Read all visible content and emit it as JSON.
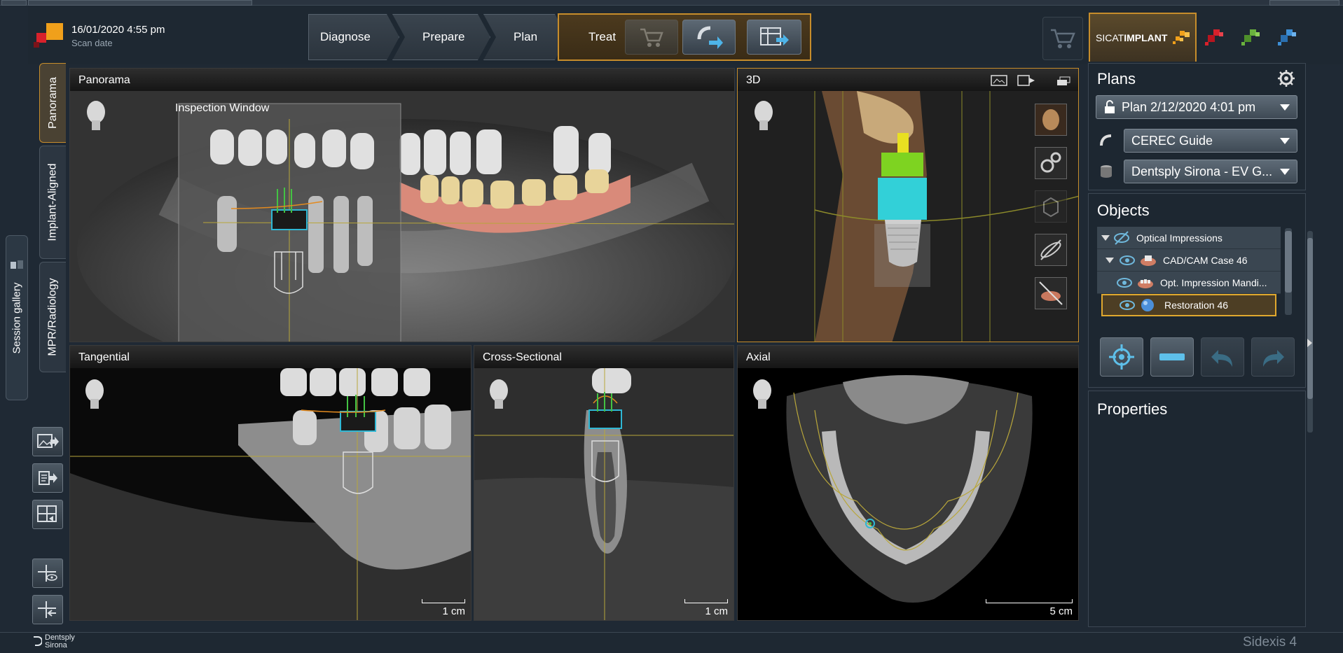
{
  "header": {
    "scan_date": "16/01/2020 4:55 pm",
    "scan_label": "Scan date"
  },
  "workflow": {
    "steps": [
      "Diagnose",
      "Prepare",
      "Plan",
      "Treat"
    ],
    "active_step": "Treat"
  },
  "apps": {
    "sicat_prefix": "SICAT",
    "sicat_suffix": "IMPLANT",
    "accent_color": "#c78d2b",
    "app_icon_colors": [
      "#d8212b",
      "#6ab23e",
      "#3d8fd6"
    ]
  },
  "left_tabs": [
    "Panorama",
    "Implant-Aligned",
    "MPR/Radiology"
  ],
  "session_gallery": "Session gallery",
  "viewports": {
    "panorama": {
      "title": "Panorama",
      "inspection": "Inspection Window"
    },
    "view3d": {
      "title": "3D"
    },
    "tangential": {
      "title": "Tangential",
      "scale": "1 cm"
    },
    "cross": {
      "title": "Cross-Sectional",
      "scale": "1 cm"
    },
    "axial": {
      "title": "Axial",
      "scale": "5 cm"
    }
  },
  "plans": {
    "title": "Plans",
    "plan_value": "Plan 2/12/2020 4:01 pm",
    "guide_value": "CEREC Guide",
    "system_value": "Dentsply Sirona - EV G..."
  },
  "objects": {
    "title": "Objects",
    "items": [
      "Optical Impressions",
      "CAD/CAM Case 46",
      "Opt. Impression Mandi...",
      "Restoration 46"
    ],
    "selected": "Restoration 46"
  },
  "properties": {
    "title": "Properties"
  },
  "footer": {
    "brand_line1": "Dentsply",
    "brand_line2": "Sirona",
    "product": "Sidexis 4"
  }
}
